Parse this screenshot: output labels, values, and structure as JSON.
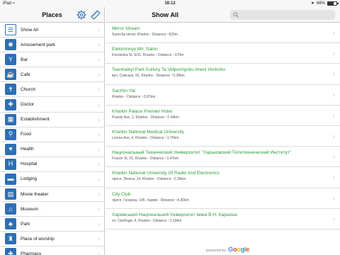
{
  "status_bar": {
    "carrier": "iPad",
    "wifi_icon": "wifi-icon",
    "time": "16:12",
    "location_icon": "location-arrow-icon",
    "battery_text": "66%",
    "battery_level": 0.66
  },
  "sidebar": {
    "title": "Places",
    "settings_icon": "gear-icon",
    "ruler_icon": "ruler-icon",
    "items": [
      {
        "label": "Show All",
        "icon": "list-icon",
        "glyph": "☰"
      },
      {
        "label": "Amusement park",
        "icon": "ferris-wheel-icon",
        "glyph": "✺"
      },
      {
        "label": "Bar",
        "icon": "cocktail-glass-icon",
        "glyph": "Y"
      },
      {
        "label": "Cafe",
        "icon": "coffee-cup-icon",
        "glyph": "☕"
      },
      {
        "label": "Church",
        "icon": "church-icon",
        "glyph": "✝"
      },
      {
        "label": "Doctor",
        "icon": "doctor-bag-icon",
        "glyph": "✚"
      },
      {
        "label": "Establishment",
        "icon": "building-icon",
        "glyph": "▦"
      },
      {
        "label": "Food",
        "icon": "fork-knife-icon",
        "glyph": "⚲"
      },
      {
        "label": "Health",
        "icon": "heart-icon",
        "glyph": "♥"
      },
      {
        "label": "Hospital",
        "icon": "hospital-icon",
        "glyph": "H"
      },
      {
        "label": "Lodging",
        "icon": "bed-icon",
        "glyph": "▬"
      },
      {
        "label": "Movie theater",
        "icon": "film-icon",
        "glyph": "▤"
      },
      {
        "label": "Museum",
        "icon": "museum-icon",
        "glyph": "⌂"
      },
      {
        "label": "Park",
        "icon": "tree-icon",
        "glyph": "♣"
      },
      {
        "label": "Place of worship",
        "icon": "worship-icon",
        "glyph": "♜"
      },
      {
        "label": "Pharmacy",
        "icon": "pharmacy-icon",
        "glyph": "✚"
      }
    ]
  },
  "main": {
    "title": "Show All",
    "search_icon": "search-icon",
    "search_placeholder": "",
    "places": [
      {
        "name": "Mirror Stream",
        "address": "Sums'ka street, Kharkiv - Distance ~620m"
      },
      {
        "name": "Elektronnyy Mir, Salon",
        "address": "Korolenka St, 6/21, Kharkiv - Distance ~370m"
      },
      {
        "name": "Tsentralnyi Park Kultury Ta Vidpochynku Imeni Horkoho",
        "address": "вул. Сумська, 81, Kharkiv - Distance ~3.39km"
      },
      {
        "name": "Sarzhin Yar",
        "address": "Kharkiv - Distance ~3.87km"
      },
      {
        "name": "Kharkiv Palace Premier Hotel",
        "address": "Pravdy Ave, 2, Kharkiv - Distance ~1.44km"
      },
      {
        "name": "Kharkiv National Medical University",
        "address": "Lenina Ave, 4, Kharkiv - Distance ~1.76km"
      },
      {
        "name": "Национальный Технический Университет \"Харьковский Политехнический Институт\"",
        "address": "Frunze St, 21, Kharkiv - Distance ~1.47km"
      },
      {
        "name": "Kharkiv National University Of Radio And Electronics",
        "address": "просп. Леніна, 14, Kharkiv - Distance ~2.39km"
      },
      {
        "name": "City Club",
        "address": "просп. Гагаріна, 145, Харків - Distance ~4.30km"
      },
      {
        "name": "Харківський Національний Університет Імені В.Н. Каразіна",
        "address": "пл. Свободи, 4, Kharkiv - Distance ~1.19km"
      }
    ],
    "footer": {
      "powered_by": "powered by",
      "google": "Google"
    }
  },
  "colors": {
    "accent": "#2d6fb5",
    "place_name": "#2a9a3a",
    "bar_bg": "#f7f7f7",
    "separator": "#dcdcdc"
  }
}
